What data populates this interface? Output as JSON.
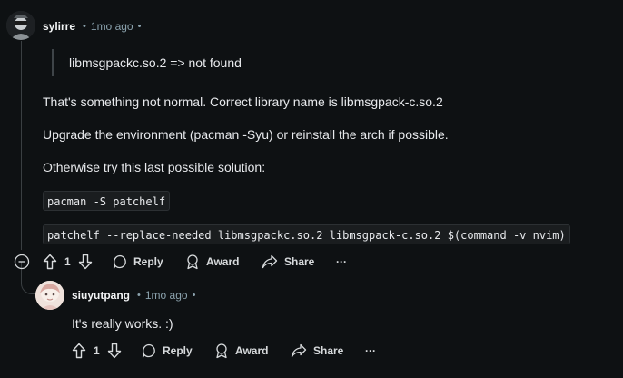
{
  "comment1": {
    "username": "sylirre",
    "separator": "•",
    "time": "1mo ago",
    "trail": "•",
    "quote": "libmsgpackc.so.2 => not found",
    "para1": "That's something not normal. Correct library name is libmsgpack-c.so.2",
    "para2": "Upgrade the environment (pacman -Syu) or reinstall the arch if possible.",
    "para3": "Otherwise try this last possible solution:",
    "code1": "pacman -S patchelf",
    "code2": "patchelf --replace-needed libmsgpackc.so.2 libmsgpack-c.so.2 $(command -v nvim)",
    "votes": "1",
    "reply_label": "Reply",
    "award_label": "Award",
    "share_label": "Share",
    "more_label": "···"
  },
  "comment2": {
    "username": "siuyutpang",
    "separator": "•",
    "time": "1mo ago",
    "trail": "•",
    "text": "It's really works. :)",
    "votes": "1",
    "reply_label": "Reply",
    "award_label": "Award",
    "share_label": "Share",
    "more_label": "···"
  },
  "icons": [
    "upvote-icon",
    "downvote-icon",
    "reply-icon",
    "award-icon",
    "share-icon",
    "collapse-icon",
    "more-icon"
  ]
}
